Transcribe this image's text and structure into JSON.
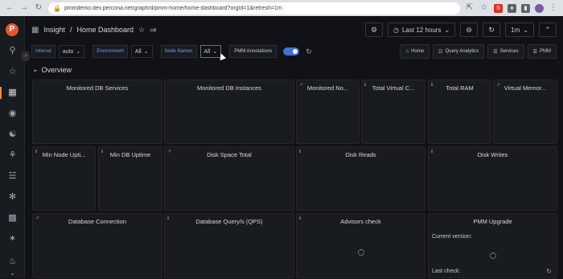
{
  "browser": {
    "url": "pmmdemo.dev.percona.net/graph/d/pmm-home/home-dashboard?orgId=1&refresh=1m"
  },
  "topbar": {
    "breadcrumb_folder": "Insight",
    "breadcrumb_separator": "/",
    "dashboard_title": "Home Dashboard",
    "time_range": "Last 12 hours",
    "refresh_interval": "1m"
  },
  "variables": {
    "interval_label": "Interval",
    "interval_value": "auto",
    "environment_label": "Environment",
    "environment_value": "All",
    "node_names_label": "Node Names",
    "node_names_value": "All",
    "annotations_label": "PMM Annotations"
  },
  "links": {
    "home": "Home",
    "query_analytics": "Query Analytics",
    "services": "Services",
    "pmm": "PMM"
  },
  "row": {
    "title": "Overview"
  },
  "panels": {
    "monitored_db_services": "Monitored DB Services",
    "monitored_db_instances": "Monitored DB Instances",
    "monitored_nodes": "Monitored No...",
    "total_virtual_cpus": "Total Virtual C...",
    "total_ram": "Total RAM",
    "virtual_memory": "Virtual Memor...",
    "min_node_uptime": "Min Node Upti...",
    "min_db_uptime": "Min DB Uptime",
    "disk_space_total": "Disk Space Total",
    "disk_reads": "Disk Reads",
    "disk_writes": "Disk Writes",
    "database_connection": "Database Connection",
    "database_queries": "Database Query/s (QPS)",
    "advisors_check": "Advisors check",
    "pmm_upgrade": "PMM Upgrade",
    "current_version_label": "Current version:",
    "last_check_label": "Last check:"
  },
  "colors": {
    "accent": "#3d71d9",
    "logo": "#e4572e",
    "background": "#111217",
    "panel": "#181b1f"
  }
}
